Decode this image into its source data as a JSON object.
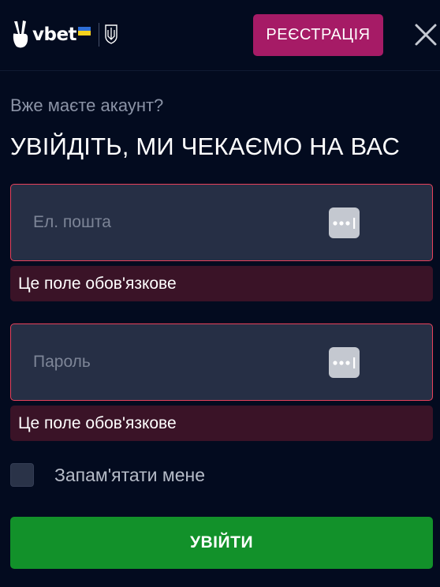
{
  "header": {
    "logo_text": "vbet",
    "register_label": "РЕЄСТРАЦІЯ"
  },
  "login": {
    "subtitle": "Вже маєте акаунт?",
    "title": "УВІЙДІТЬ, МИ ЧЕКАЄМО НА ВАС",
    "email": {
      "placeholder": "Ел. пошта",
      "value": "",
      "error": "Це поле обов'язкове"
    },
    "password": {
      "placeholder": "Пароль",
      "value": "",
      "error": "Це поле обов'язкове"
    },
    "remember_label": "Запам'ятати мене",
    "remember_checked": false,
    "submit_label": "УВІЙТИ"
  },
  "colors": {
    "background": "#030b1f",
    "register_button": "#a61b66",
    "login_button": "#12912a",
    "field_border_error": "#e9415b",
    "error_background": "#3a1327"
  },
  "icons": [
    "vbet-hand-logo-icon",
    "ukraine-flag-icon",
    "ukraine-crest-icon",
    "close-icon",
    "password-manager-icon",
    "password-manager-icon"
  ]
}
